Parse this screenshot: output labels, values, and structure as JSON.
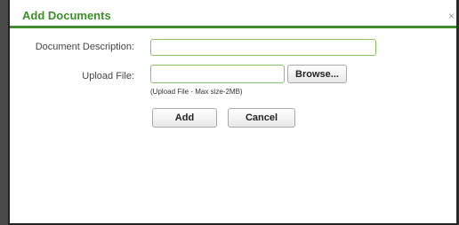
{
  "dialog": {
    "title": "Add Documents",
    "close_glyph": "×"
  },
  "form": {
    "description_label": "Document Description:",
    "description_value": "",
    "upload_label": "Upload File:",
    "upload_value": "",
    "browse_label": "Browse...",
    "upload_hint": "(Upload File - Max size-2MB)",
    "add_label": "Add",
    "cancel_label": "Cancel"
  },
  "colors": {
    "accent": "#3e8e2b",
    "input_border": "#8cc068"
  }
}
